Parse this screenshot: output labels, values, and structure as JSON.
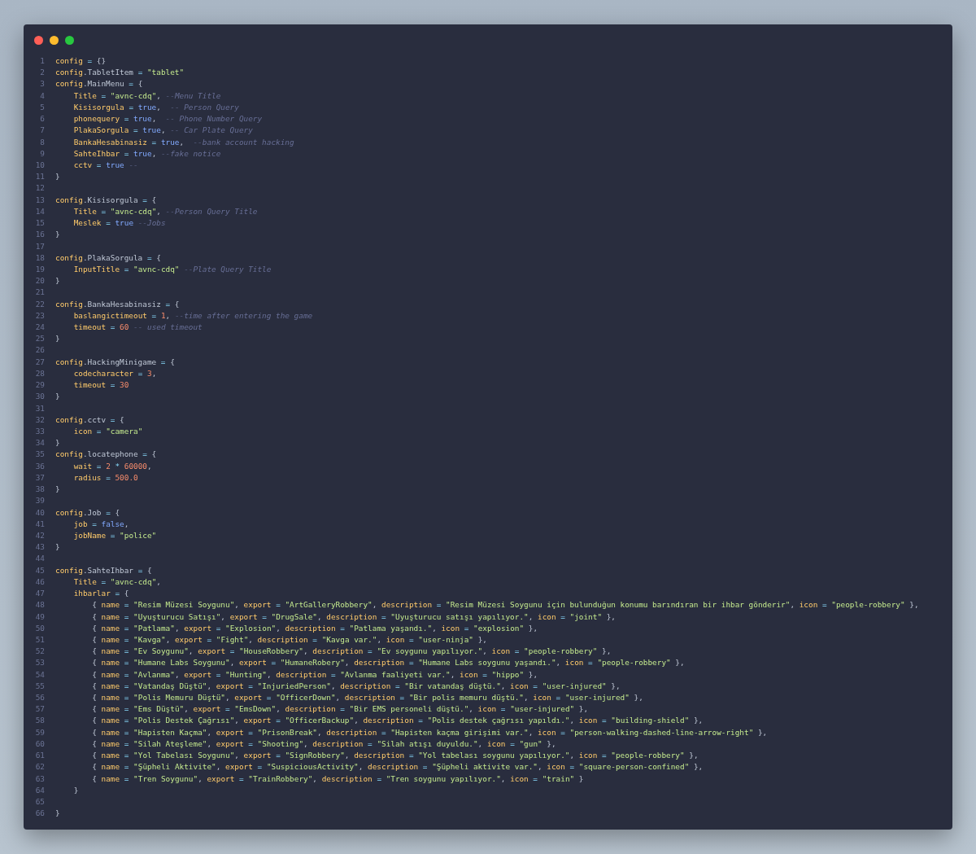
{
  "window_controls": [
    {
      "color": "#ff5f57"
    },
    {
      "color": "#febc2e"
    },
    {
      "color": "#28c840"
    }
  ],
  "lines": [
    {
      "n": "1",
      "code": "config = {}"
    },
    {
      "n": "2",
      "code": "config.TabletItem = \"tablet\""
    },
    {
      "n": "3",
      "code": "config.MainMenu = {"
    },
    {
      "n": "4",
      "code": "    Title = \"avnc-cdq\", --Menu Title"
    },
    {
      "n": "5",
      "code": "    Kisisorgula = true,  -- Person Query"
    },
    {
      "n": "6",
      "code": "    phonequery = true,  -- Phone Number Query"
    },
    {
      "n": "7",
      "code": "    PlakaSorgula = true, -- Car Plate Query"
    },
    {
      "n": "8",
      "code": "    BankaHesabinasiz = true,  --bank account hacking"
    },
    {
      "n": "9",
      "code": "    SahteIhbar = true, --fake notice"
    },
    {
      "n": "10",
      "code": "    cctv = true --"
    },
    {
      "n": "11",
      "code": "}"
    },
    {
      "n": "12"
    },
    {
      "n": "13",
      "code": "config.Kisisorgula = {"
    },
    {
      "n": "14",
      "code": "    Title = \"avnc-cdq\", --Person Query Title"
    },
    {
      "n": "15",
      "code": "    Meslek = true --Jobs"
    },
    {
      "n": "16",
      "code": "}"
    },
    {
      "n": "17"
    },
    {
      "n": "18",
      "code": "config.PlakaSorgula = {"
    },
    {
      "n": "19",
      "code": "    InputTitle = \"avnc-cdq\" --Plate Query Title"
    },
    {
      "n": "20",
      "code": "}"
    },
    {
      "n": "21"
    },
    {
      "n": "22",
      "code": "config.BankaHesabinasiz = {"
    },
    {
      "n": "23",
      "code": "    baslangictimeout = 1, --time after entering the game"
    },
    {
      "n": "24",
      "code": "    timeout = 60 -- used timeout"
    },
    {
      "n": "25",
      "code": "}"
    },
    {
      "n": "26"
    },
    {
      "n": "27",
      "code": "config.HackingMinigame = {"
    },
    {
      "n": "28",
      "code": "    codecharacter = 3,"
    },
    {
      "n": "29",
      "code": "    timeout = 30"
    },
    {
      "n": "30",
      "code": "}"
    },
    {
      "n": "31"
    },
    {
      "n": "32",
      "code": "config.cctv = {"
    },
    {
      "n": "33",
      "code": "    icon = \"camera\""
    },
    {
      "n": "34",
      "code": "}"
    },
    {
      "n": "35",
      "code": "config.locatephone = {"
    },
    {
      "n": "36",
      "code": "    wait = 2 * 60000,"
    },
    {
      "n": "37",
      "code": "    radius = 500.0"
    },
    {
      "n": "38",
      "code": "}"
    },
    {
      "n": "39"
    },
    {
      "n": "40",
      "code": "config.Job = {"
    },
    {
      "n": "41",
      "code": "    job = false,"
    },
    {
      "n": "42",
      "code": "    jobName = \"police\""
    },
    {
      "n": "43",
      "code": "}"
    },
    {
      "n": "44"
    },
    {
      "n": "45",
      "code": "config.SahteIhbar = {"
    },
    {
      "n": "46",
      "code": "    Title = \"avnc-cdq\","
    },
    {
      "n": "47",
      "code": "    ihbarlar = {"
    },
    {
      "n": "48",
      "code": "        { name = \"Resim Müzesi Soygunu\", export = \"ArtGalleryRobbery\", description = \"Resim Müzesi Soygunu için bulunduğun konumu barındıran bir ihbar gönderir\", icon = \"people-robbery\" },"
    },
    {
      "n": "49",
      "code": "        { name = \"Uyuşturucu Satışı\", export = \"DrugSale\", description = \"Uyuşturucu satışı yapılıyor.\", icon = \"joint\" },"
    },
    {
      "n": "50",
      "code": "        { name = \"Patlama\", export = \"Explosion\", description = \"Patlama yaşandı.\", icon = \"explosion\" },"
    },
    {
      "n": "51",
      "code": "        { name = \"Kavga\", export = \"Fight\", description = \"Kavga var.\", icon = \"user-ninja\" },"
    },
    {
      "n": "52",
      "code": "        { name = \"Ev Soygunu\", export = \"HouseRobbery\", description = \"Ev soygunu yapılıyor.\", icon = \"people-robbery\" },"
    },
    {
      "n": "53",
      "code": "        { name = \"Humane Labs Soygunu\", export = \"HumaneRobery\", description = \"Humane Labs soygunu yaşandı.\", icon = \"people-robbery\" },"
    },
    {
      "n": "54",
      "code": "        { name = \"Avlanma\", export = \"Hunting\", description = \"Avlanma faaliyeti var.\", icon = \"hippo\" },"
    },
    {
      "n": "55",
      "code": "        { name = \"Vatandaş Düştü\", export = \"InjuriedPerson\", description = \"Bir vatandaş düştü.\", icon = \"user-injured\" },"
    },
    {
      "n": "56",
      "code": "        { name = \"Polis Memuru Düştü\", export = \"OfficerDown\", description = \"Bir polis memuru düştü.\", icon = \"user-injured\" },"
    },
    {
      "n": "57",
      "code": "        { name = \"Ems Düştü\", export = \"EmsDown\", description = \"Bir EMS personeli düştü.\", icon = \"user-injured\" },"
    },
    {
      "n": "58",
      "code": "        { name = \"Polis Destek Çağrısı\", export = \"OfficerBackup\", description = \"Polis destek çağrısı yapıldı.\", icon = \"building-shield\" },"
    },
    {
      "n": "59",
      "code": "        { name = \"Hapisten Kaçma\", export = \"PrisonBreak\", description = \"Hapisten kaçma girişimi var.\", icon = \"person-walking-dashed-line-arrow-right\" },"
    },
    {
      "n": "60",
      "code": "        { name = \"Silah Ateşleme\", export = \"Shooting\", description = \"Silah atışı duyuldu.\", icon = \"gun\" },"
    },
    {
      "n": "61",
      "code": "        { name = \"Yol Tabelası Soygunu\", export = \"SignRobbery\", description = \"Yol tabelası soygunu yapılıyor.\", icon = \"people-robbery\" },"
    },
    {
      "n": "62",
      "code": "        { name = \"Şüpheli Aktivite\", export = \"SuspiciousActivity\", description = \"Şüpheli aktivite var.\", icon = \"square-person-confined\" },"
    },
    {
      "n": "63",
      "code": "        { name = \"Tren Soygunu\", export = \"TrainRobbery\", description = \"Tren soygunu yapılıyor.\", icon = \"train\" }"
    },
    {
      "n": "64",
      "code": "    }"
    },
    {
      "n": "65"
    },
    {
      "n": "66",
      "code": "}"
    }
  ]
}
